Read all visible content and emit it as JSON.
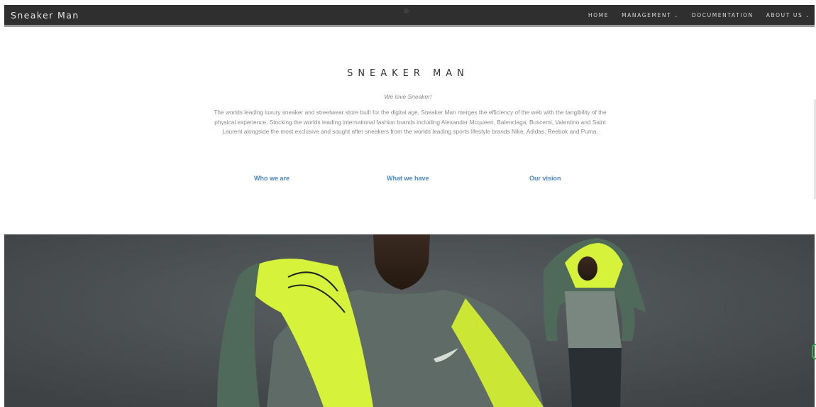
{
  "navbar": {
    "brand": "Sneaker Man",
    "links": [
      {
        "label": "HOME",
        "has_dropdown": false
      },
      {
        "label": "MANAGEMENT",
        "has_dropdown": true
      },
      {
        "label": "DOCUMENTATION",
        "has_dropdown": false
      },
      {
        "label": "ABOUT US",
        "has_dropdown": true
      }
    ],
    "caret": "⌄"
  },
  "intro": {
    "title": "SNEAKER MAN",
    "tagline": "We love Sneaker!",
    "description": "The worlds leading luxury sneaker and streetwear store built for the digital age, Sneaker Man merges the efficiency of the web with the tangibility of the physical experience. Stocking the worlds leading international fashion brands including Alexander Mcqueen, Balenciaga, Buscemi, Valentino and Saint Laurent alongside the most exclusive and sought after sneakers from the worlds leading sports lifestyle brands Nike, Adidas, Reebok and Puma."
  },
  "info_links": [
    {
      "label": "Who we are"
    },
    {
      "label": "What we have"
    },
    {
      "label": "Our vision"
    }
  ],
  "colors": {
    "navbar_bg": "#2f2f2f",
    "link_blue": "#4a86c8",
    "hero_bg": "#4a4e50",
    "jacket_neon": "#d6f23a",
    "jacket_green": "#4f6a5a"
  }
}
